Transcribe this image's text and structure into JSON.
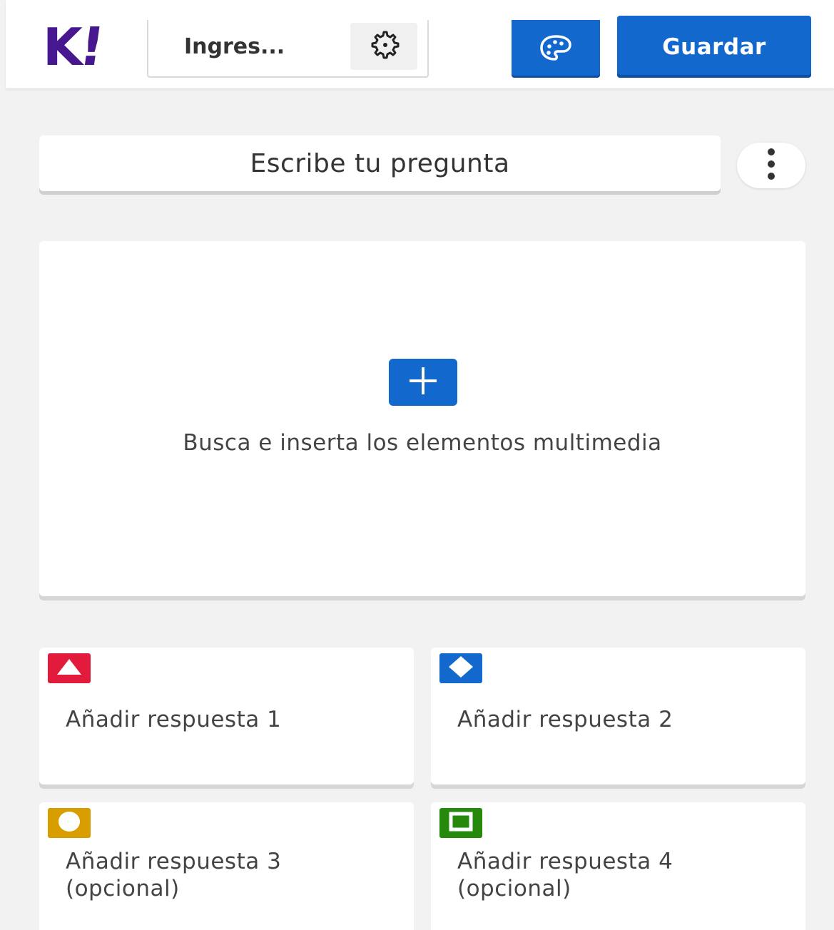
{
  "header": {
    "logo": {
      "k": "K",
      "bang": "!",
      "color": "#46178f"
    },
    "title_preview": "Ingres...",
    "settings_icon": "gear-icon",
    "theme_icon": "palette-icon",
    "save_label": "Guardar",
    "accent_color": "#1368ce"
  },
  "question": {
    "placeholder": "Escribe tu pregunta",
    "menu_icon": "kebab-menu-icon"
  },
  "media": {
    "add_icon": "plus-icon",
    "prompt": "Busca e inserta los elementos multimedia"
  },
  "answers": [
    {
      "label": "Añadir respuesta 1",
      "shape": "triangle-icon",
      "color": "#e21b3c"
    },
    {
      "label": "Añadir respuesta 2",
      "shape": "diamond-icon",
      "color": "#1368ce"
    },
    {
      "label": "Añadir respuesta 3 (opcional)",
      "shape": "circle-icon",
      "color": "#d89e00"
    },
    {
      "label": "Añadir respuesta 4 (opcional)",
      "shape": "square-icon",
      "color": "#26890c"
    }
  ]
}
